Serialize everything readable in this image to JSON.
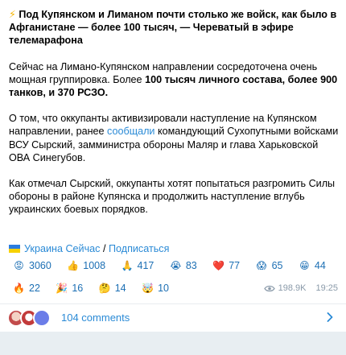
{
  "post": {
    "headline_icon": "lightning-icon",
    "headline": "Под Купянском и Лиманом почти столько же войск, как было в Афганистане — более 100 тысяч, — Череватый в эфире телемарафона",
    "p2_a": "Сейчас на Лимано-Купянском направлении сосредоточена очень мощная группировка. Более ",
    "p2_b": "100 тысяч личного состава, более 900 танков, и 370 РСЗО.",
    "p3_a": "О том, что оккупанты активизировали наступление на Купянском направлении, ранее ",
    "p3_link": "сообщали",
    "p3_b": " командующий Сухопутными войсками ВСУ Сырский, замминистра обороны Маляр и глава Харьковской ОВА Синегубов.",
    "p4": "Как отмечал Сырский, оккупанты хотят попытаться разгромить Силы обороны в районе Купянска и продолжить наступление вглубь украинских боевых порядков.",
    "source_name": "Украина Сейчас",
    "source_sep": " / ",
    "source_subscribe": "Подписаться",
    "source_flag_colors": [
      "#2c7de0",
      "#f7d100"
    ]
  },
  "reactions": [
    {
      "icon": "angry-face-icon",
      "glyph": "😡",
      "count": "3060"
    },
    {
      "icon": "thumbs-up-icon",
      "glyph": "👍",
      "count": "1008"
    },
    {
      "icon": "praying-hands-icon",
      "glyph": "🙏",
      "count": "417"
    },
    {
      "icon": "crying-face-icon",
      "glyph": "😭",
      "count": "83"
    },
    {
      "icon": "red-heart-icon",
      "glyph": "❤️",
      "count": "77"
    },
    {
      "icon": "shocked-face-icon",
      "glyph": "😱",
      "count": "65"
    },
    {
      "icon": "grinning-face-icon",
      "glyph": "😁",
      "count": "44"
    },
    {
      "icon": "fire-icon",
      "glyph": "🔥",
      "count": "22"
    },
    {
      "icon": "party-popper-icon",
      "glyph": "🎉",
      "count": "16"
    },
    {
      "icon": "thinking-face-icon",
      "glyph": "🤔",
      "count": "14"
    },
    {
      "icon": "exploding-head-icon",
      "glyph": "🤯",
      "count": "10"
    }
  ],
  "meta": {
    "views": "198.9K",
    "time": "19:25"
  },
  "comments": {
    "label": "104 comments"
  },
  "colors": {
    "link": "#2a8ad6",
    "reaction_text": "#1c6fb4",
    "meta": "#8a9aa9",
    "bottom_bar": "#e8eef2"
  }
}
